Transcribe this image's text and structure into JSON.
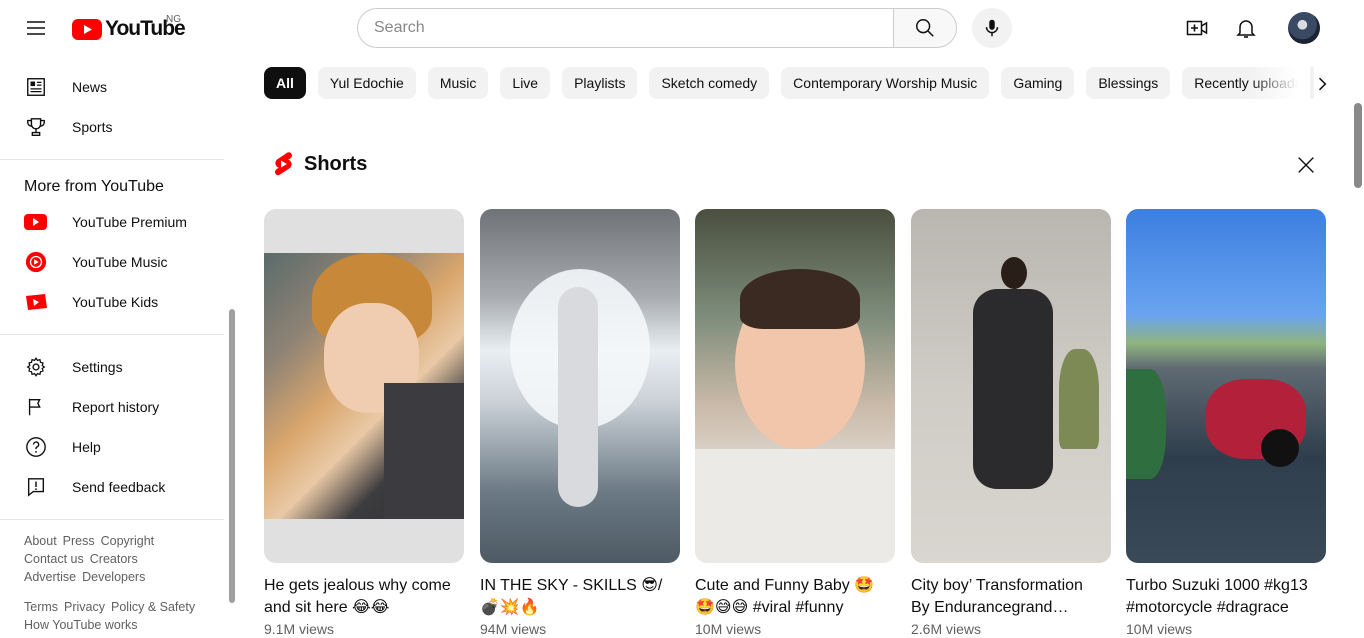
{
  "header": {
    "logo_text": "YouTube",
    "country_code": "NG",
    "search_placeholder": "Search"
  },
  "sidebar": {
    "top_items": [
      {
        "label": "News",
        "icon": "news-icon"
      },
      {
        "label": "Sports",
        "icon": "trophy-icon"
      }
    ],
    "more_heading": "More from YouTube",
    "more_items": [
      {
        "label": "YouTube Premium",
        "icon": "youtube-premium-icon"
      },
      {
        "label": "YouTube Music",
        "icon": "youtube-music-icon"
      },
      {
        "label": "YouTube Kids",
        "icon": "youtube-kids-icon"
      }
    ],
    "settings_items": [
      {
        "label": "Settings",
        "icon": "gear-icon"
      },
      {
        "label": "Report history",
        "icon": "flag-icon"
      },
      {
        "label": "Help",
        "icon": "help-icon"
      },
      {
        "label": "Send feedback",
        "icon": "feedback-icon"
      }
    ],
    "footer_row1": [
      "About",
      "Press",
      "Copyright"
    ],
    "footer_row2": [
      "Contact us",
      "Creators"
    ],
    "footer_row3": [
      "Advertise",
      "Developers"
    ],
    "footer_row4": [
      "Terms",
      "Privacy",
      "Policy & Safety"
    ],
    "footer_row5": [
      "How YouTube works"
    ]
  },
  "chips": [
    "All",
    "Yul Edochie",
    "Music",
    "Live",
    "Playlists",
    "Sketch comedy",
    "Contemporary Worship Music",
    "Gaming",
    "Blessings",
    "Recently uploaded"
  ],
  "shorts": {
    "title": "Shorts",
    "items": [
      {
        "title": "He gets jealous why come and sit here 😂😂",
        "views": "9.1M views"
      },
      {
        "title": "IN THE SKY - SKILLS 😎/💣💥🔥",
        "views": "94M views"
      },
      {
        "title": "Cute and Funny Baby 🤩🤩😅😅 #viral #funny",
        "views": "10M views"
      },
      {
        "title": "City boy’ Transformation By Endurancegrand #fashion",
        "views": "2.6M views"
      },
      {
        "title": "Turbo Suzuki 1000 #kg13 #motorcycle #dragrace",
        "views": "10M views"
      }
    ]
  },
  "colors": {
    "brand_red": "#ff0000",
    "chip_active_bg": "#0f0f0f",
    "chip_bg": "#f2f2f2"
  }
}
